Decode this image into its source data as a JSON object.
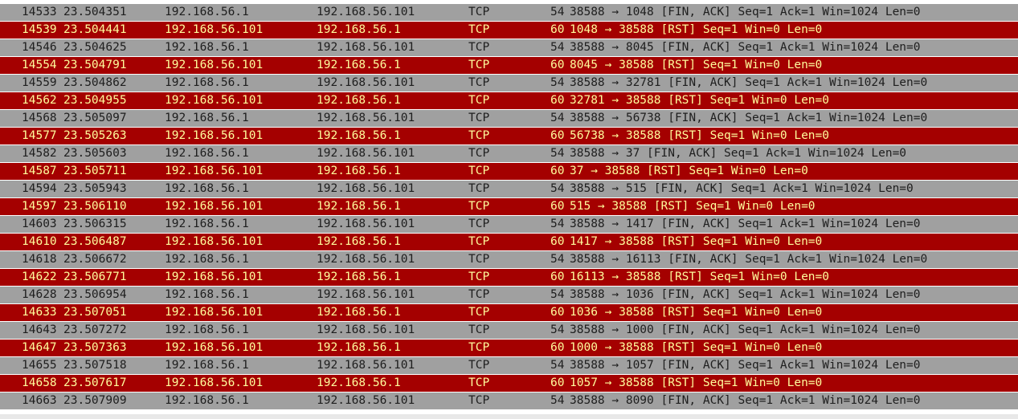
{
  "packets": [
    {
      "no": "14533",
      "time": "23.504351",
      "src": "192.168.56.1",
      "dst": "192.168.56.101",
      "proto": "TCP",
      "len": "54",
      "info": "38588 → 1048 [FIN, ACK] Seq=1 Ack=1 Win=1024 Len=0",
      "kind": "fin"
    },
    {
      "no": "14539",
      "time": "23.504441",
      "src": "192.168.56.101",
      "dst": "192.168.56.1",
      "proto": "TCP",
      "len": "60",
      "info": "1048 → 38588 [RST] Seq=1 Win=0 Len=0",
      "kind": "rst"
    },
    {
      "no": "14546",
      "time": "23.504625",
      "src": "192.168.56.1",
      "dst": "192.168.56.101",
      "proto": "TCP",
      "len": "54",
      "info": "38588 → 8045 [FIN, ACK] Seq=1 Ack=1 Win=1024 Len=0",
      "kind": "fin"
    },
    {
      "no": "14554",
      "time": "23.504791",
      "src": "192.168.56.101",
      "dst": "192.168.56.1",
      "proto": "TCP",
      "len": "60",
      "info": "8045 → 38588 [RST] Seq=1 Win=0 Len=0",
      "kind": "rst"
    },
    {
      "no": "14559",
      "time": "23.504862",
      "src": "192.168.56.1",
      "dst": "192.168.56.101",
      "proto": "TCP",
      "len": "54",
      "info": "38588 → 32781 [FIN, ACK] Seq=1 Ack=1 Win=1024 Len=0",
      "kind": "fin"
    },
    {
      "no": "14562",
      "time": "23.504955",
      "src": "192.168.56.101",
      "dst": "192.168.56.1",
      "proto": "TCP",
      "len": "60",
      "info": "32781 → 38588 [RST] Seq=1 Win=0 Len=0",
      "kind": "rst"
    },
    {
      "no": "14568",
      "time": "23.505097",
      "src": "192.168.56.1",
      "dst": "192.168.56.101",
      "proto": "TCP",
      "len": "54",
      "info": "38588 → 56738 [FIN, ACK] Seq=1 Ack=1 Win=1024 Len=0",
      "kind": "fin"
    },
    {
      "no": "14577",
      "time": "23.505263",
      "src": "192.168.56.101",
      "dst": "192.168.56.1",
      "proto": "TCP",
      "len": "60",
      "info": "56738 → 38588 [RST] Seq=1 Win=0 Len=0",
      "kind": "rst"
    },
    {
      "no": "14582",
      "time": "23.505603",
      "src": "192.168.56.1",
      "dst": "192.168.56.101",
      "proto": "TCP",
      "len": "54",
      "info": "38588 → 37 [FIN, ACK] Seq=1 Ack=1 Win=1024 Len=0",
      "kind": "fin"
    },
    {
      "no": "14587",
      "time": "23.505711",
      "src": "192.168.56.101",
      "dst": "192.168.56.1",
      "proto": "TCP",
      "len": "60",
      "info": "37 → 38588 [RST] Seq=1 Win=0 Len=0",
      "kind": "rst"
    },
    {
      "no": "14594",
      "time": "23.505943",
      "src": "192.168.56.1",
      "dst": "192.168.56.101",
      "proto": "TCP",
      "len": "54",
      "info": "38588 → 515 [FIN, ACK] Seq=1 Ack=1 Win=1024 Len=0",
      "kind": "fin"
    },
    {
      "no": "14597",
      "time": "23.506110",
      "src": "192.168.56.101",
      "dst": "192.168.56.1",
      "proto": "TCP",
      "len": "60",
      "info": "515 → 38588 [RST] Seq=1 Win=0 Len=0",
      "kind": "rst"
    },
    {
      "no": "14603",
      "time": "23.506315",
      "src": "192.168.56.1",
      "dst": "192.168.56.101",
      "proto": "TCP",
      "len": "54",
      "info": "38588 → 1417 [FIN, ACK] Seq=1 Ack=1 Win=1024 Len=0",
      "kind": "fin"
    },
    {
      "no": "14610",
      "time": "23.506487",
      "src": "192.168.56.101",
      "dst": "192.168.56.1",
      "proto": "TCP",
      "len": "60",
      "info": "1417 → 38588 [RST] Seq=1 Win=0 Len=0",
      "kind": "rst"
    },
    {
      "no": "14618",
      "time": "23.506672",
      "src": "192.168.56.1",
      "dst": "192.168.56.101",
      "proto": "TCP",
      "len": "54",
      "info": "38588 → 16113 [FIN, ACK] Seq=1 Ack=1 Win=1024 Len=0",
      "kind": "fin"
    },
    {
      "no": "14622",
      "time": "23.506771",
      "src": "192.168.56.101",
      "dst": "192.168.56.1",
      "proto": "TCP",
      "len": "60",
      "info": "16113 → 38588 [RST] Seq=1 Win=0 Len=0",
      "kind": "rst"
    },
    {
      "no": "14628",
      "time": "23.506954",
      "src": "192.168.56.1",
      "dst": "192.168.56.101",
      "proto": "TCP",
      "len": "54",
      "info": "38588 → 1036 [FIN, ACK] Seq=1 Ack=1 Win=1024 Len=0",
      "kind": "fin"
    },
    {
      "no": "14633",
      "time": "23.507051",
      "src": "192.168.56.101",
      "dst": "192.168.56.1",
      "proto": "TCP",
      "len": "60",
      "info": "1036 → 38588 [RST] Seq=1 Win=0 Len=0",
      "kind": "rst"
    },
    {
      "no": "14643",
      "time": "23.507272",
      "src": "192.168.56.1",
      "dst": "192.168.56.101",
      "proto": "TCP",
      "len": "54",
      "info": "38588 → 1000 [FIN, ACK] Seq=1 Ack=1 Win=1024 Len=0",
      "kind": "fin"
    },
    {
      "no": "14647",
      "time": "23.507363",
      "src": "192.168.56.101",
      "dst": "192.168.56.1",
      "proto": "TCP",
      "len": "60",
      "info": "1000 → 38588 [RST] Seq=1 Win=0 Len=0",
      "kind": "rst"
    },
    {
      "no": "14655",
      "time": "23.507518",
      "src": "192.168.56.1",
      "dst": "192.168.56.101",
      "proto": "TCP",
      "len": "54",
      "info": "38588 → 1057 [FIN, ACK] Seq=1 Ack=1 Win=1024 Len=0",
      "kind": "fin"
    },
    {
      "no": "14658",
      "time": "23.507617",
      "src": "192.168.56.101",
      "dst": "192.168.56.1",
      "proto": "TCP",
      "len": "60",
      "info": "1057 → 38588 [RST] Seq=1 Win=0 Len=0",
      "kind": "rst"
    },
    {
      "no": "14663",
      "time": "23.507909",
      "src": "192.168.56.1",
      "dst": "192.168.56.101",
      "proto": "TCP",
      "len": "54",
      "info": "38588 → 8090 [FIN, ACK] Seq=1 Ack=1 Win=1024 Len=0",
      "kind": "fin"
    }
  ],
  "colors": {
    "fin_bg": "#a0a0a0",
    "fin_fg": "#1e1e1e",
    "rst_bg": "#a40000",
    "rst_fg": "#fffc9c"
  }
}
